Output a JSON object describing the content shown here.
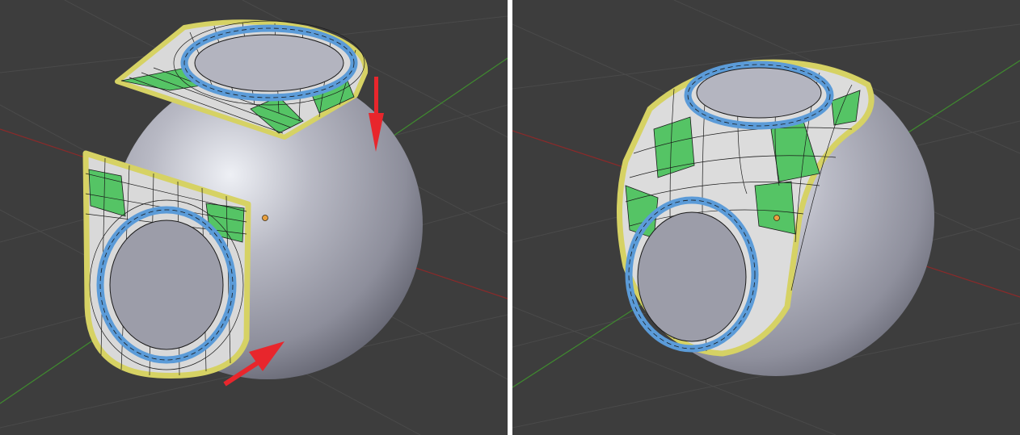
{
  "colors": {
    "background": "#3d3d3d",
    "grid": "#4a4a4a",
    "axis_x": "#8a2a2a",
    "axis_y": "#3f8a2f",
    "sphere_light": "#e2e3ea",
    "sphere_mid": "#a3a4b0",
    "sphere_dark": "#4d4e5a",
    "mesh_face": "#d8d8d8",
    "mesh_wire": "#1a1a1a",
    "mesh_green": "#55c465",
    "mesh_blue_ring": "#5b9bd8",
    "mesh_yellow_border": "#d6d264",
    "arrow_red": "#e8262c",
    "origin_dot": "#e8a040",
    "divider": "#ffffff"
  },
  "viewports": [
    {
      "id": "before",
      "icons": [
        "sphere-object",
        "mesh-patch-top",
        "mesh-patch-front",
        "move-arrow-down",
        "move-arrow-diagonal",
        "origin-dot"
      ]
    },
    {
      "id": "after",
      "icons": [
        "sphere-object",
        "shrinkwrapped-mesh",
        "origin-dot"
      ]
    }
  ]
}
